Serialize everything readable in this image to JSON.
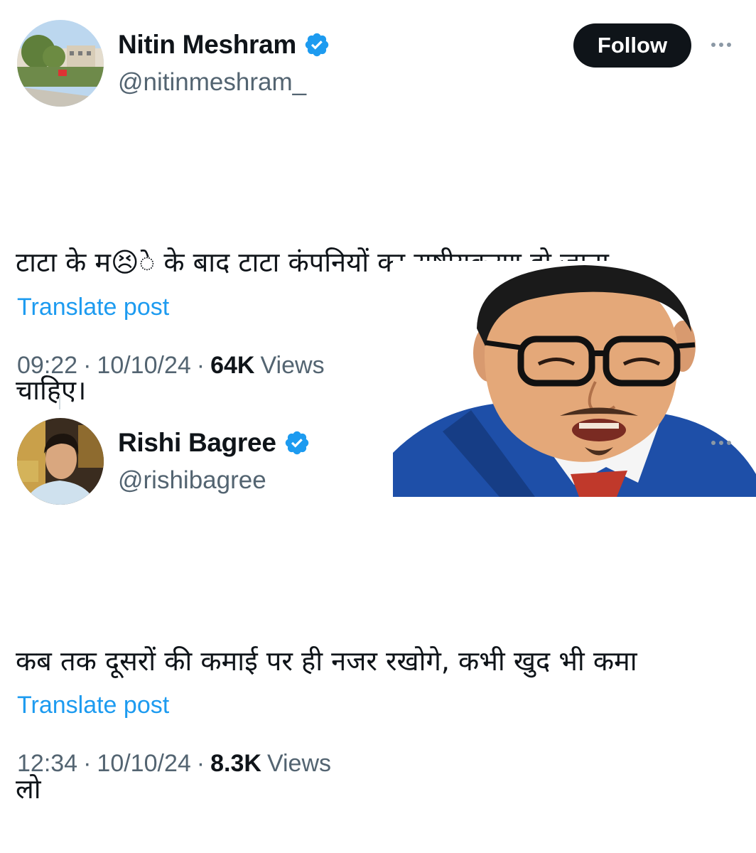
{
  "post1": {
    "author_name": "Nitin Meshram",
    "handle": "@nitinmeshram_",
    "follow_label": "Follow",
    "text_line1": "टाटा के म😣े के बाद टाटा कंपनियों का राष्ट्रीयकरण हो जाना",
    "text_line2": "चाहिए।",
    "translate_label": "Translate post",
    "time": "09:22",
    "sep1": "·",
    "date": "10/10/24",
    "sep2": "·",
    "views_count": "64K",
    "views_label": "Views"
  },
  "post2": {
    "author_name": "Rishi Bagree",
    "handle": "@rishibagree",
    "text_line1": "कब तक दूसरों की कमाई पर ही नजर रखोगे, कभी खुद भी कमा",
    "text_line2": "लो",
    "translate_label": "Translate post",
    "time": "12:34",
    "sep1": "·",
    "date": "10/10/24",
    "sep2": "·",
    "views_count": "8.3K",
    "views_label": "Views"
  },
  "colors": {
    "link": "#1d9bf0",
    "verified": "#1d9bf0",
    "secondary_text": "#536471",
    "button_bg": "#0f1419"
  },
  "icons": {
    "verified": "verified-badge-icon",
    "more": "more-options-icon"
  }
}
